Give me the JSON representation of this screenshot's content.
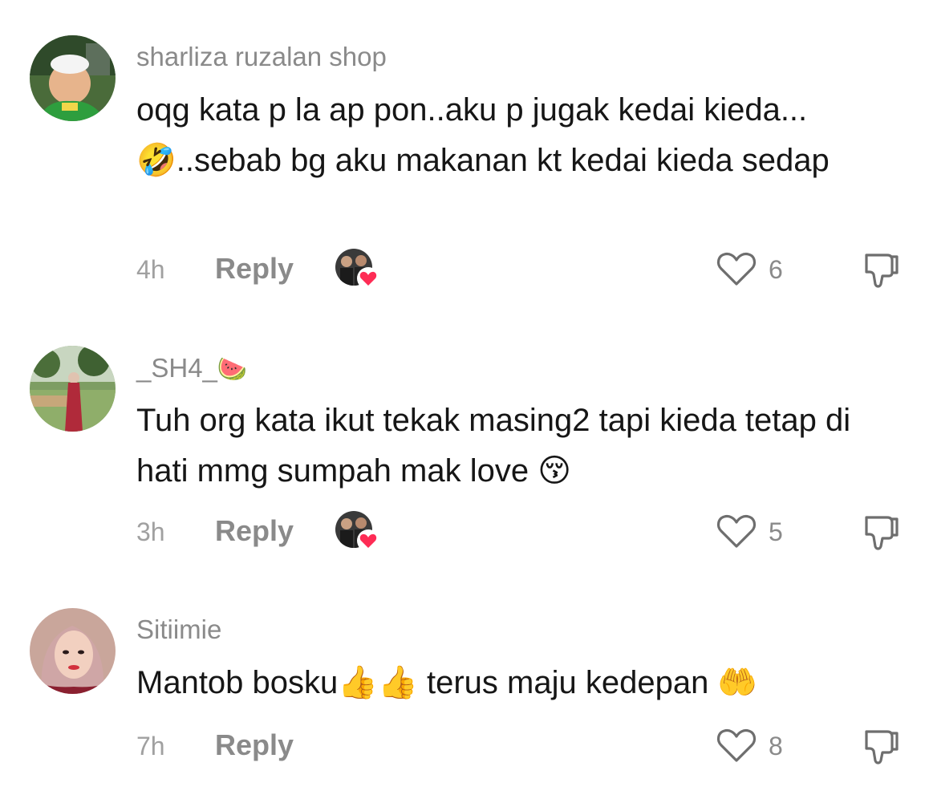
{
  "comments": [
    {
      "username": "sharliza ruzalan shop",
      "username_emoji": "",
      "text": "oqg kata p la ap pon..aku p jugak kedai kieda...🤣..sebab bg aku makanan kt kedai kieda sedap",
      "time": "4h",
      "reply_label": "Reply",
      "likes": "6"
    },
    {
      "username": "_SH4_",
      "username_emoji": "🍉",
      "text": "Tuh org kata ikut tekak masing2 tapi kieda tetap di hati mmg sumpah mak love 😚",
      "time": "3h",
      "reply_label": "Reply",
      "likes": "5"
    },
    {
      "username": "Sitiimie",
      "username_emoji": "",
      "text": "Mantob bosku👍👍 terus maju kedepan 🤲",
      "time": "7h",
      "reply_label": "Reply",
      "likes": "8"
    }
  ],
  "colors": {
    "text": "#161616",
    "muted": "#8a8a8a",
    "heart_badge": "#fe2c55"
  },
  "icons": {
    "like": "heart-outline-icon",
    "dislike": "thumbs-down-icon",
    "creator_liked": "creator-heart-badge-icon"
  }
}
